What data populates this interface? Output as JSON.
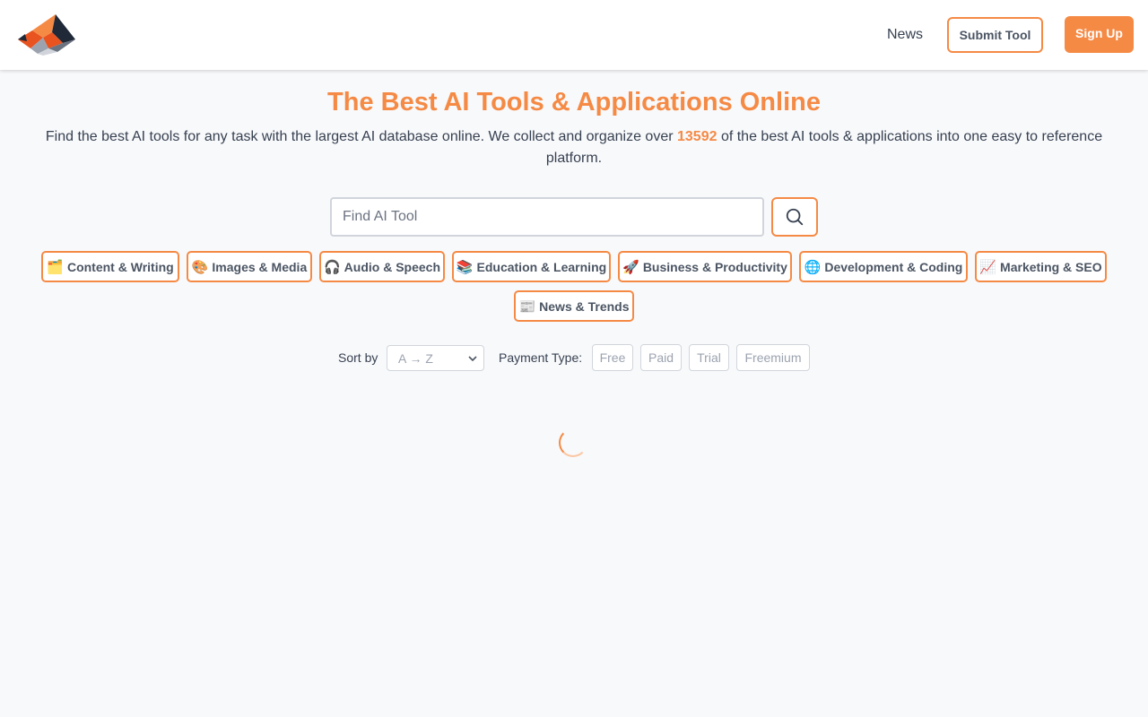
{
  "header": {
    "logo_label": "",
    "nav_news": "News",
    "submit_tool": "Submit Tool",
    "sign_up": "Sign Up"
  },
  "hero": {
    "title": "The Best AI Tools & Applications Online",
    "sub_before": "Find the best AI tools for any task with the largest AI database online. We collect and organize over ",
    "count": "13592",
    "sub_after": " of the best AI tools & applications into one easy to reference platform."
  },
  "search": {
    "placeholder": "Find AI Tool",
    "icon": "search-icon"
  },
  "categories": [
    {
      "emoji": "🗂️",
      "label": "Content & Writing",
      "icon": "folder-icon"
    },
    {
      "emoji": "🎨",
      "label": "Images & Media",
      "icon": "palette-icon"
    },
    {
      "emoji": "🎧",
      "label": "Audio & Speech",
      "icon": "headphones-icon"
    },
    {
      "emoji": "📚",
      "label": "Education & Learning",
      "icon": "books-icon"
    },
    {
      "emoji": "🚀",
      "label": "Business & Productivity",
      "icon": "rocket-icon"
    },
    {
      "emoji": "🌐",
      "label": "Development & Coding",
      "icon": "globe-icon"
    },
    {
      "emoji": "📈",
      "label": "Marketing & SEO",
      "icon": "chart-icon"
    },
    {
      "emoji": "📰",
      "label": "News & Trends",
      "icon": "newspaper-icon"
    }
  ],
  "filters": {
    "sort_label": "Sort by",
    "sort_value": "A → Z",
    "payment_label": "Payment Type:",
    "payment_options": [
      "Free",
      "Paid",
      "Trial",
      "Freemium"
    ]
  },
  "colors": {
    "accent": "#f58a45",
    "background": "#f8f9fb"
  }
}
